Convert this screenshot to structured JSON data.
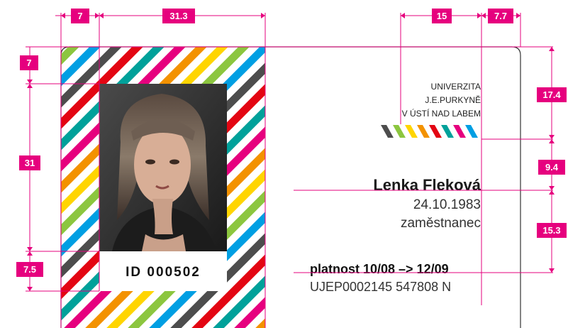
{
  "card": {
    "university": [
      "UNIVERZITA",
      "J.E.PURKYNĚ",
      "V ÚSTÍ NAD LABEM"
    ],
    "name": "Lenka Fleková",
    "birth_date": "24.10.1983",
    "role": "zaměstnanec",
    "validity": "platnost 10/08 –> 12/09",
    "code": "UJEP0002145 547808 N",
    "id_label": "ID 000502"
  },
  "dimensions": {
    "top_left_margin": "7",
    "photo_width": "31.3",
    "logo_width": "15",
    "right_margin": "7.7",
    "left_top_margin": "7",
    "photo_height": "31",
    "id_strip_height": "7.5",
    "logo_top": "17.4",
    "name_gap": "9.4",
    "text_block": "15.3"
  },
  "colors": {
    "dimension": "#e6007e",
    "stripes": [
      "#e6007e",
      "#f39200",
      "#ffd500",
      "#8cc63f",
      "#009fe3",
      "#4d4d4d",
      "#e30613",
      "#00a19a"
    ]
  },
  "icons": {
    "photo": "person-portrait-icon",
    "logo": "stripe-logo-icon"
  }
}
